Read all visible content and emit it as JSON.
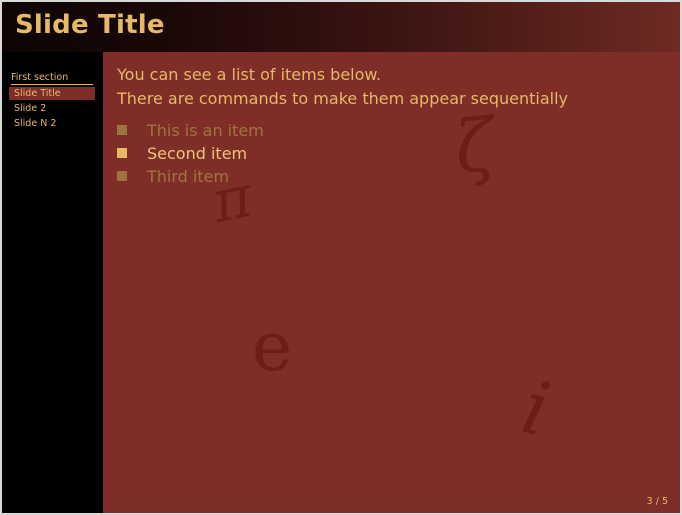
{
  "slide": {
    "title": "Slide Title",
    "page_number": "3 / 5"
  },
  "sidebar": {
    "section": "First section",
    "items": [
      {
        "label": "Slide Title",
        "active": true
      },
      {
        "label": "Slide 2",
        "active": false
      },
      {
        "label": "Slide N 2",
        "active": false
      }
    ]
  },
  "content": {
    "line1": "You can see a list of items below.",
    "line2": "There are commands to make them appear sequentially",
    "items": [
      "This is an item",
      "Second item",
      "Third item"
    ]
  },
  "decorations": {
    "pi": "π",
    "zeta": "ζ",
    "e": "e",
    "i": "i"
  },
  "colors": {
    "background": "#7f2e27",
    "accent": "#e6b868",
    "sidebar": "#000000"
  }
}
